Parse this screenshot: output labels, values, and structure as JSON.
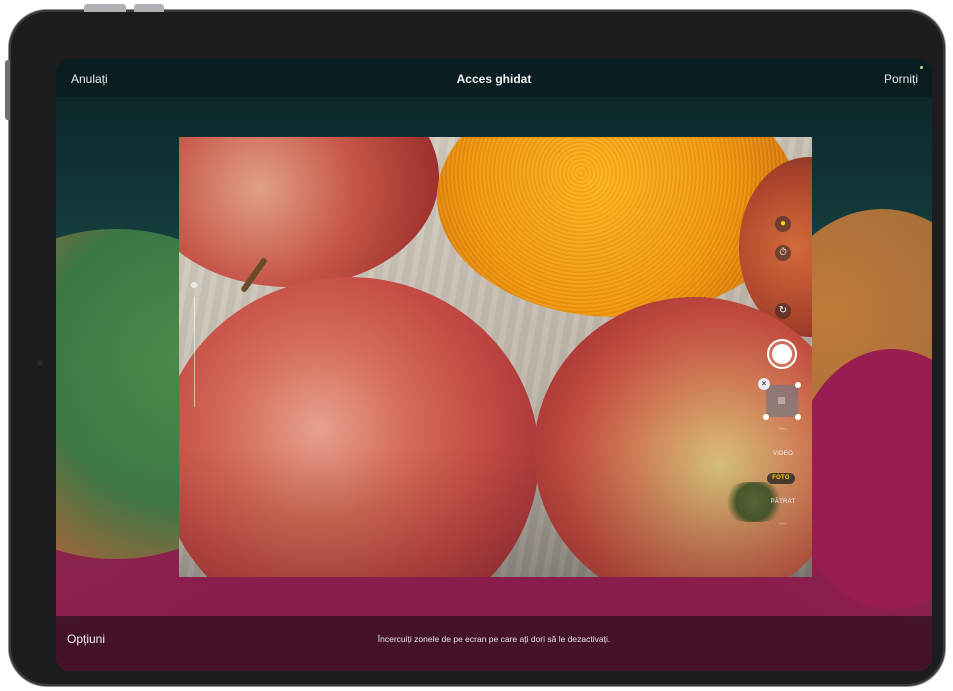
{
  "device": {
    "model": "iPad"
  },
  "topbar": {
    "cancel_label": "Anulați",
    "title": "Acces ghidat",
    "start_label": "Porniți"
  },
  "bottombar": {
    "options_label": "Opțiuni",
    "instruction": "Încercuiți zonele de pe ecran pe care ați dori să le dezactivați."
  },
  "camera": {
    "icons": [
      "flash-icon",
      "timer-icon",
      "switch-camera-icon"
    ],
    "modes": [
      {
        "label": "VIDEO",
        "selected": false
      },
      {
        "label": "FOTO",
        "selected": true
      },
      {
        "label": "PĂTRAT",
        "selected": false
      }
    ],
    "selection_close_glyph": "×"
  },
  "colors": {
    "accent_mode": "#ffd60a",
    "top_bar": "#0a1c20",
    "bottom_bar": "#3a1226"
  }
}
